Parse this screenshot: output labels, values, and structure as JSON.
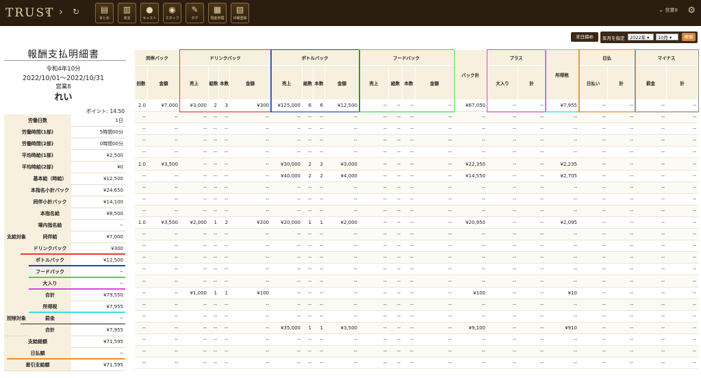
{
  "app": {
    "logo": "TRUST",
    "nav": {
      "back": "‹",
      "forward": "›",
      "reload": "↻"
    },
    "tools": [
      {
        "label": "まとめ",
        "icon": "clipboard-icon",
        "glyph": "▤"
      },
      {
        "label": "収支",
        "icon": "bar-chart-icon",
        "glyph": "▥"
      },
      {
        "label": "キャスト",
        "icon": "person-icon",
        "glyph": "●"
      },
      {
        "label": "スタッフ",
        "icon": "staff-icon",
        "glyph": "◉"
      },
      {
        "label": "タグ",
        "icon": "tag-icon",
        "glyph": "✎"
      },
      {
        "label": "現金管理",
        "icon": "cash-icon",
        "glyph": "▦"
      },
      {
        "label": "日報登録",
        "icon": "report-icon",
        "glyph": "▧"
      }
    ],
    "user": "営業8",
    "user_chevron": "⌄",
    "settings_icon": "gear-icon"
  },
  "statement": {
    "title": "報酬支払明細書",
    "month": "令和4年10分",
    "period": "2022/10/01〜2022/10/31",
    "store": "営業8",
    "name": "れい",
    "points": "ポイント: 14.50"
  },
  "controls": {
    "close_button": "末日締め",
    "period_label": "年月を指定",
    "year": "2022年",
    "month": "10月",
    "search_button": "検索"
  },
  "summary": {
    "group_payment": "支給対象",
    "group_deduction": "控除対象",
    "rows": [
      {
        "label": "労働日数",
        "value": "1日"
      },
      {
        "label": "労働時間(1部)",
        "value": "5時間00分"
      },
      {
        "label": "労働時間(2部)",
        "value": "0時間00分"
      },
      {
        "label": "平均時給(1部)",
        "value": "¥2,500"
      },
      {
        "label": "平均時給(2部)",
        "value": "¥0"
      },
      {
        "label": "基本給（時給）",
        "value": "¥12,500"
      },
      {
        "label": "本指名小計バック",
        "value": "¥24,650"
      },
      {
        "label": "同伴小計バック",
        "value": "¥14,100"
      },
      {
        "label": "本指名給",
        "value": "¥8,500"
      },
      {
        "label": "場内指名給",
        "value": "--"
      },
      {
        "label": "同伴給",
        "value": "¥7,000"
      },
      {
        "label": "ドリンクバック",
        "value": "¥300"
      },
      {
        "label": "ボトルバック",
        "value": "¥12,500"
      },
      {
        "label": "フードバック",
        "value": "--"
      },
      {
        "label": "大入り",
        "value": "--"
      },
      {
        "label": "合計",
        "value": "¥79,550"
      },
      {
        "label": "所得税",
        "value": "¥7,955"
      },
      {
        "label": "罰金",
        "value": "--"
      },
      {
        "label": "合計",
        "value": "¥7,955"
      },
      {
        "label": "支給総額",
        "value": "¥71,595"
      },
      {
        "label": "日払額",
        "value": "--"
      },
      {
        "label": "差引支給額",
        "value": "¥71,595"
      }
    ]
  },
  "table": {
    "groups": [
      "同伴バック",
      "ドリンクバック",
      "ボトルバック",
      "フードバック",
      "バック計",
      "プラス",
      "所得税",
      "日払",
      "マイナス"
    ],
    "columns": [
      "回数",
      "金額",
      "売上",
      "組数",
      "本数",
      "金額",
      "売上",
      "組数",
      "本数",
      "金額",
      "売上",
      "組数",
      "本数",
      "金額",
      "",
      "大入り",
      "計",
      "",
      "日払い",
      "計",
      "罰金",
      "計"
    ],
    "dash": "--",
    "rows": [
      [
        "2.0",
        "¥7,000",
        "¥3,000",
        "2",
        "3",
        "¥300",
        "¥125,000",
        "6",
        "6",
        "¥12,500",
        "--",
        "--",
        "--",
        "--",
        "¥67,050",
        "--",
        "--",
        "¥7,955",
        "--",
        "--",
        "--",
        "--"
      ],
      [
        "--",
        "--",
        "--",
        "--",
        "--",
        "--",
        "--",
        "--",
        "--",
        "--",
        "--",
        "--",
        "--",
        "--",
        "--",
        "--",
        "--",
        "--",
        "--",
        "--",
        "--",
        "--"
      ],
      [
        "--",
        "--",
        "--",
        "--",
        "--",
        "--",
        "--",
        "--",
        "--",
        "--",
        "--",
        "--",
        "--",
        "--",
        "--",
        "--",
        "--",
        "--",
        "--",
        "--",
        "--",
        "--"
      ],
      [
        "--",
        "--",
        "--",
        "--",
        "--",
        "--",
        "--",
        "--",
        "--",
        "--",
        "--",
        "--",
        "--",
        "--",
        "--",
        "--",
        "--",
        "--",
        "--",
        "--",
        "--",
        "--"
      ],
      [
        "--",
        "--",
        "--",
        "--",
        "--",
        "--",
        "--",
        "--",
        "--",
        "--",
        "--",
        "--",
        "--",
        "--",
        "--",
        "--",
        "--",
        "--",
        "--",
        "--",
        "--",
        "--"
      ],
      [
        "1.0",
        "¥3,500",
        "--",
        "--",
        "--",
        "--",
        "¥30,000",
        "2",
        "2",
        "¥3,000",
        "--",
        "--",
        "--",
        "--",
        "¥22,350",
        "--",
        "--",
        "¥2,235",
        "--",
        "--",
        "--",
        "--"
      ],
      [
        "--",
        "--",
        "--",
        "--",
        "--",
        "--",
        "¥40,000",
        "2",
        "2",
        "¥4,000",
        "--",
        "--",
        "--",
        "--",
        "¥14,550",
        "--",
        "--",
        "¥2,705",
        "--",
        "--",
        "--",
        "--"
      ],
      [
        "--",
        "--",
        "--",
        "--",
        "--",
        "--",
        "--",
        "--",
        "--",
        "--",
        "--",
        "--",
        "--",
        "--",
        "--",
        "--",
        "--",
        "--",
        "--",
        "--",
        "--",
        "--"
      ],
      [
        "--",
        "--",
        "--",
        "--",
        "--",
        "--",
        "--",
        "--",
        "--",
        "--",
        "--",
        "--",
        "--",
        "--",
        "--",
        "--",
        "--",
        "--",
        "--",
        "--",
        "--",
        "--"
      ],
      [
        "--",
        "--",
        "--",
        "--",
        "--",
        "--",
        "--",
        "--",
        "--",
        "--",
        "--",
        "--",
        "--",
        "--",
        "--",
        "--",
        "--",
        "--",
        "--",
        "--",
        "--",
        "--"
      ],
      [
        "1.0",
        "¥3,500",
        "¥2,000",
        "1",
        "2",
        "¥200",
        "¥20,000",
        "1",
        "1",
        "¥2,000",
        "--",
        "--",
        "--",
        "--",
        "¥20,950",
        "--",
        "--",
        "¥2,095",
        "--",
        "--",
        "--",
        "--"
      ],
      [
        "--",
        "--",
        "--",
        "--",
        "--",
        "--",
        "--",
        "--",
        "--",
        "--",
        "--",
        "--",
        "--",
        "--",
        "--",
        "--",
        "--",
        "--",
        "--",
        "--",
        "--",
        "--"
      ],
      [
        "--",
        "--",
        "--",
        "--",
        "--",
        "--",
        "--",
        "--",
        "--",
        "--",
        "--",
        "--",
        "--",
        "--",
        "--",
        "--",
        "--",
        "--",
        "--",
        "--",
        "--",
        "--"
      ],
      [
        "--",
        "--",
        "--",
        "--",
        "--",
        "--",
        "--",
        "--",
        "--",
        "--",
        "--",
        "--",
        "--",
        "--",
        "--",
        "--",
        "--",
        "--",
        "--",
        "--",
        "--",
        "--"
      ],
      [
        "--",
        "--",
        "--",
        "--",
        "--",
        "--",
        "--",
        "--",
        "--",
        "--",
        "--",
        "--",
        "--",
        "--",
        "--",
        "--",
        "--",
        "--",
        "--",
        "--",
        "--",
        "--"
      ],
      [
        "--",
        "--",
        "--",
        "--",
        "--",
        "--",
        "--",
        "--",
        "--",
        "--",
        "--",
        "--",
        "--",
        "--",
        "--",
        "--",
        "--",
        "--",
        "--",
        "--",
        "--",
        "--"
      ],
      [
        "--",
        "--",
        "¥1,000",
        "1",
        "1",
        "¥100",
        "--",
        "--",
        "--",
        "--",
        "--",
        "--",
        "--",
        "--",
        "¥100",
        "--",
        "--",
        "¥10",
        "--",
        "--",
        "--",
        "--"
      ],
      [
        "--",
        "--",
        "--",
        "--",
        "--",
        "--",
        "--",
        "--",
        "--",
        "--",
        "--",
        "--",
        "--",
        "--",
        "--",
        "--",
        "--",
        "--",
        "--",
        "--",
        "--",
        "--"
      ],
      [
        "--",
        "--",
        "--",
        "--",
        "--",
        "--",
        "--",
        "--",
        "--",
        "--",
        "--",
        "--",
        "--",
        "--",
        "--",
        "--",
        "--",
        "--",
        "--",
        "--",
        "--",
        "--"
      ],
      [
        "--",
        "--",
        "--",
        "--",
        "--",
        "--",
        "¥35,000",
        "1",
        "1",
        "¥3,500",
        "--",
        "--",
        "--",
        "--",
        "¥9,100",
        "--",
        "--",
        "¥910",
        "--",
        "--",
        "--",
        "--"
      ],
      [
        "--",
        "--",
        "--",
        "--",
        "--",
        "--",
        "--",
        "--",
        "--",
        "--",
        "--",
        "--",
        "--",
        "--",
        "--",
        "--",
        "--",
        "--",
        "--",
        "--",
        "--",
        "--"
      ],
      [
        "--",
        "--",
        "--",
        "--",
        "--",
        "--",
        "--",
        "--",
        "--",
        "--",
        "--",
        "--",
        "--",
        "--",
        "--",
        "--",
        "--",
        "--",
        "--",
        "--",
        "--",
        "--"
      ],
      [
        "--",
        "--",
        "--",
        "--",
        "--",
        "--",
        "--",
        "--",
        "--",
        "--",
        "--",
        "--",
        "--",
        "--",
        "--",
        "--",
        "--",
        "--",
        "--",
        "--",
        "--",
        "--"
      ]
    ]
  },
  "highlight_colors": {
    "drink": "#e53935",
    "bottle": "#1e3fbf",
    "food": "#3ddc3d",
    "plus": "#e040e0",
    "tax": "#33e0e0",
    "daily": "#f08c2a",
    "minus": "#888888"
  }
}
